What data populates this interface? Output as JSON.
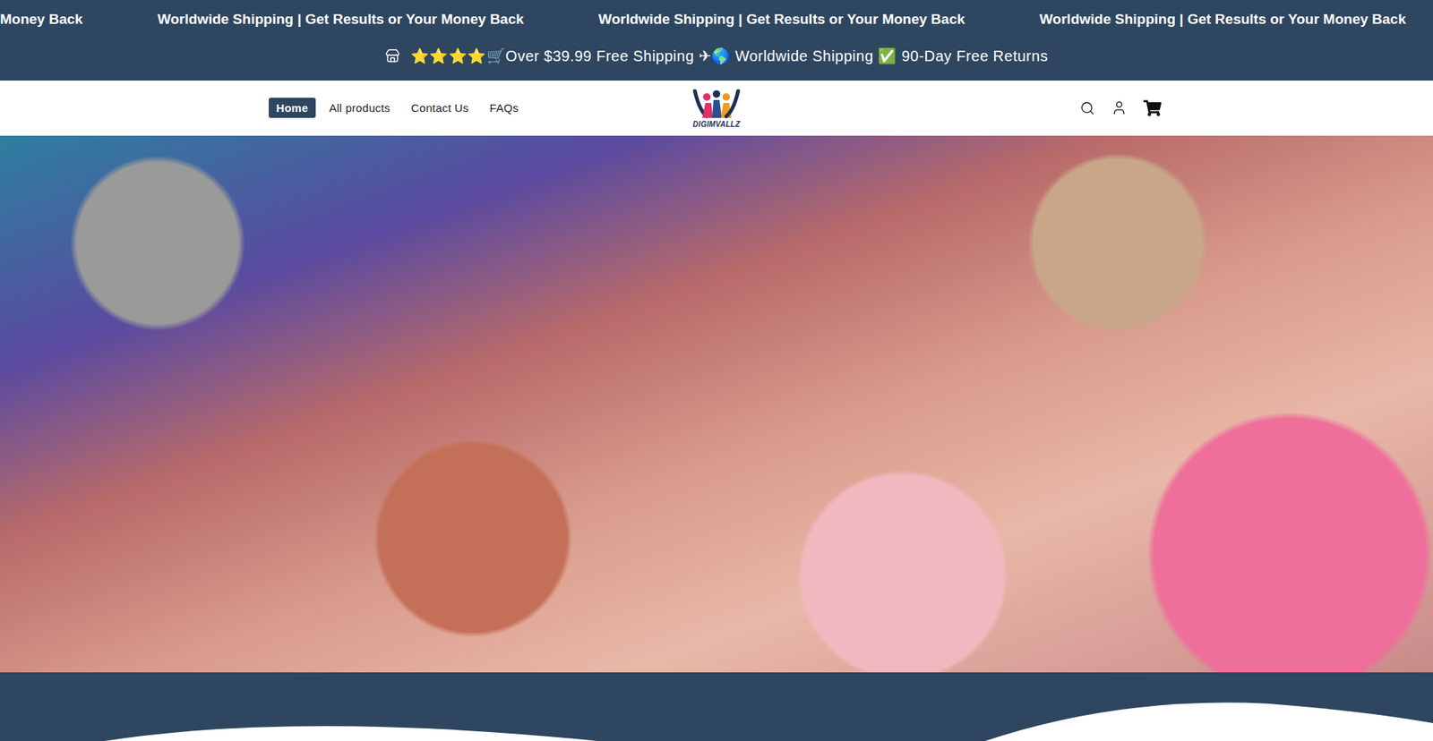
{
  "marquee": [
    "Money Back",
    "Worldwide Shipping | Get Results or Your Money Back",
    "Worldwide Shipping | Get Results or Your Money Back",
    "Worldwide Shipping | Get Results or Your Money Back"
  ],
  "announcement": {
    "text": "⭐⭐⭐⭐🛒Over $39.99 Free Shipping ✈🌎 Worldwide Shipping ✅ 90-Day Free Returns"
  },
  "nav": {
    "items": [
      {
        "label": "Home",
        "selected": true
      },
      {
        "label": "All products",
        "selected": false
      },
      {
        "label": "Contact Us",
        "selected": false
      },
      {
        "label": "FAQs",
        "selected": false
      }
    ]
  },
  "logo": {
    "text": "DIGIMVALLZ"
  }
}
